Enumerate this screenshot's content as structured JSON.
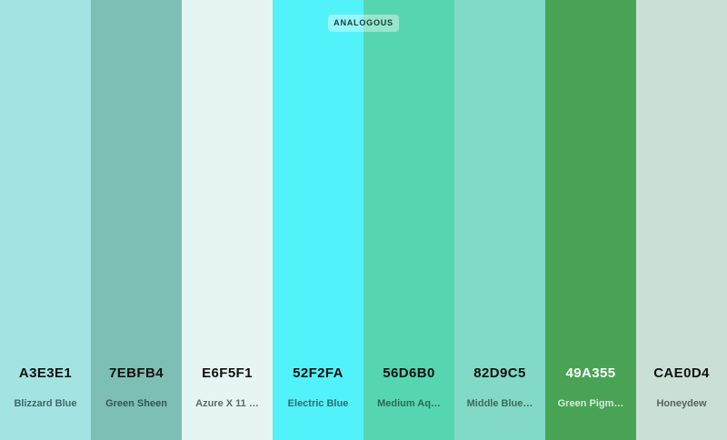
{
  "badge_label": "ANALOGOUS",
  "swatches": [
    {
      "hex": "A3E3E1",
      "name": "Blizzard Blue",
      "color": "#A3E3E1",
      "hex_color": "#111111",
      "name_color": "#3f6966"
    },
    {
      "hex": "7EBFB4",
      "name": "Green Sheen",
      "color": "#7EBFB4",
      "hex_color": "#111111",
      "name_color": "#2f5752"
    },
    {
      "hex": "E6F5F1",
      "name": "Azure X 11 …",
      "color": "#E6F5F1",
      "hex_color": "#111111",
      "name_color": "#5c6a67"
    },
    {
      "hex": "52F2FA",
      "name": "Electric Blue",
      "color": "#52F2FA",
      "hex_color": "#111111",
      "name_color": "#2b6e72"
    },
    {
      "hex": "56D6B0",
      "name": "Medium Aq…",
      "color": "#56D6B0",
      "hex_color": "#111111",
      "name_color": "#2b6a57"
    },
    {
      "hex": "82D9C5",
      "name": "Middle Blue…",
      "color": "#82D9C5",
      "hex_color": "#111111",
      "name_color": "#3d6a5f"
    },
    {
      "hex": "49A355",
      "name": "Green Pigm…",
      "color": "#49A355",
      "hex_color": "#ffffff",
      "name_color": "#d5ecd8"
    },
    {
      "hex": "CAE0D4",
      "name": "Honeydew",
      "color": "#CAE0D4",
      "hex_color": "#111111",
      "name_color": "#56645c"
    }
  ]
}
